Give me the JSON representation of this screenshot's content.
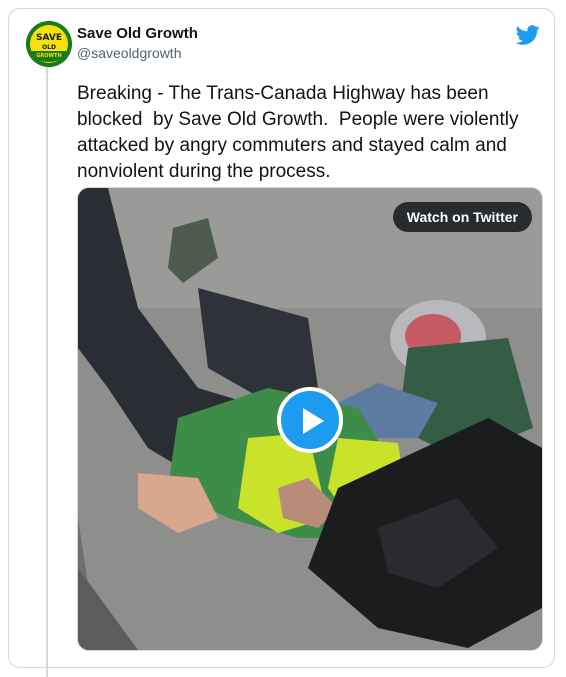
{
  "tweet": {
    "display_name": "Save Old Growth",
    "handle": "@saveoldgrowth",
    "text": "Breaking - The Trans-Canada Highway has been blocked  by Save Old Growth.  People were violently attacked by angry commuters and stayed calm and nonviolent during the process."
  },
  "avatar": {
    "line1": "SAVE",
    "line2": "OLD",
    "line3": "GROWTH",
    "colors": {
      "outer": "#1a7a1e",
      "inner": "#f5e20b",
      "text": "#1a1a1a"
    }
  },
  "media": {
    "watch_label": "Watch on Twitter",
    "play_icon": "play-icon"
  },
  "colors": {
    "twitter_blue": "#1d9bf0",
    "text": "#0f1419",
    "muted": "#536471",
    "border": "#cfd9de"
  },
  "icons": {
    "brand": "twitter-bird-icon"
  }
}
